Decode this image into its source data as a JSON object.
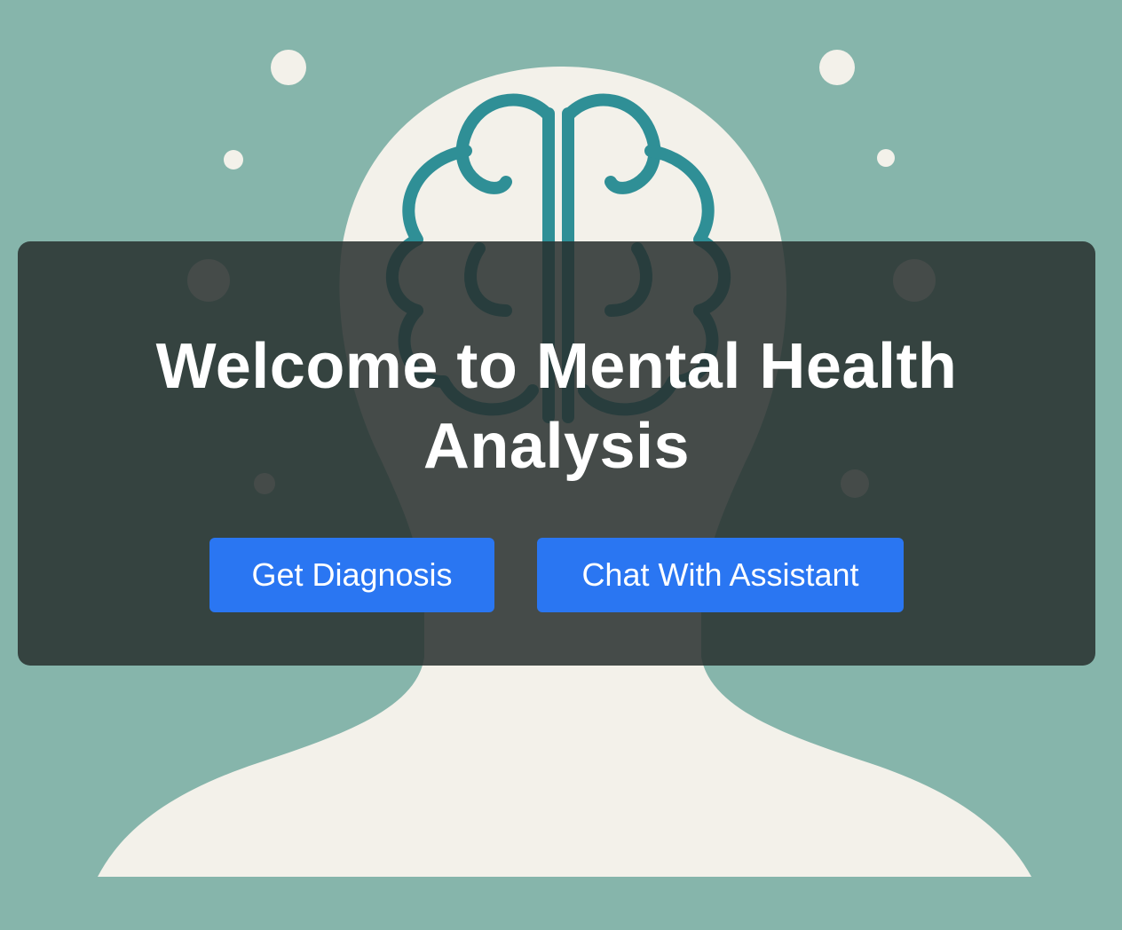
{
  "colors": {
    "background": "#86b5ab",
    "head_silhouette": "#f3f1ea",
    "brain_outline": "#2f8f96",
    "overlay": "#28302e",
    "button": "#2a76f2",
    "button_text": "#ffffff"
  },
  "hero": {
    "title": "Welcome to Mental Health Analysis",
    "illustration": "head-with-brain-icon"
  },
  "actions": {
    "diagnosis_label": "Get Diagnosis",
    "chat_label": "Chat With Assistant"
  }
}
